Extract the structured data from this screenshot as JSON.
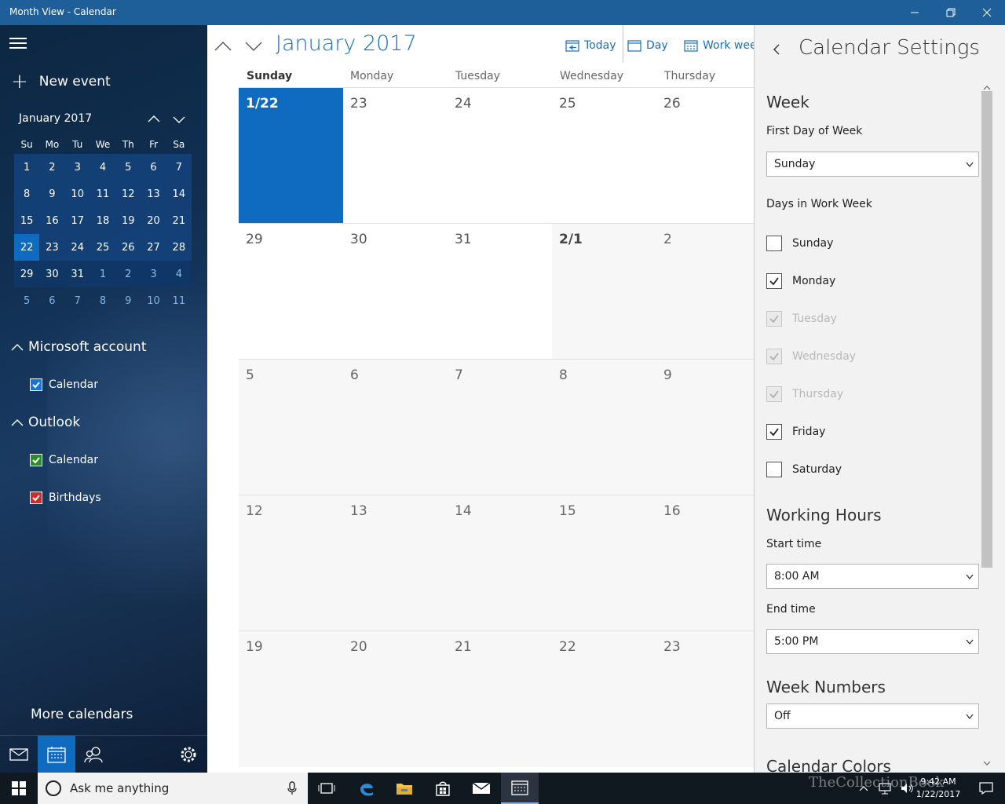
{
  "window": {
    "title": "Month View - Calendar"
  },
  "sidebar": {
    "new_event": "New event",
    "mini_calendar": {
      "title": "January 2017",
      "dow": [
        "Su",
        "Mo",
        "Tu",
        "We",
        "Th",
        "Fr",
        "Sa"
      ],
      "weeks": [
        [
          "1",
          "2",
          "3",
          "4",
          "5",
          "6",
          "7"
        ],
        [
          "8",
          "9",
          "10",
          "11",
          "12",
          "13",
          "14"
        ],
        [
          "15",
          "16",
          "17",
          "18",
          "19",
          "20",
          "21"
        ],
        [
          "22",
          "23",
          "24",
          "25",
          "26",
          "27",
          "28"
        ],
        [
          "29",
          "30",
          "31",
          "1",
          "2",
          "3",
          "4"
        ],
        [
          "5",
          "6",
          "7",
          "8",
          "9",
          "10",
          "11"
        ]
      ],
      "selected": "22"
    },
    "accounts": [
      {
        "name": "Microsoft account",
        "calendars": [
          {
            "label": "Calendar",
            "color": "#1a73d9"
          }
        ]
      },
      {
        "name": "Outlook",
        "calendars": [
          {
            "label": "Calendar",
            "color": "#2e8b2e"
          },
          {
            "label": "Birthdays",
            "color": "#c4302b"
          }
        ]
      }
    ],
    "more_calendars": "More calendars"
  },
  "main": {
    "month_title": "January 2017",
    "toolbar": {
      "today": "Today",
      "day": "Day",
      "work_week": "Work week"
    },
    "dow": [
      "Sunday",
      "Monday",
      "Tuesday",
      "Wednesday",
      "Thursday"
    ],
    "weeks": [
      [
        "1/22",
        "23",
        "24",
        "25",
        "26"
      ],
      [
        "29",
        "30",
        "31",
        "2/1",
        "2"
      ],
      [
        "5",
        "6",
        "7",
        "8",
        "9"
      ],
      [
        "12",
        "13",
        "14",
        "15",
        "16"
      ],
      [
        "19",
        "20",
        "21",
        "22",
        "23"
      ]
    ],
    "accent": "#0e6bbf"
  },
  "settings": {
    "title": "Calendar Settings",
    "week_section": "Week",
    "first_day_label": "First Day of Week",
    "first_day_value": "Sunday",
    "work_week_label": "Days in Work Week",
    "work_days": [
      {
        "label": "Sunday",
        "checked": false,
        "disabled": false
      },
      {
        "label": "Monday",
        "checked": true,
        "disabled": false
      },
      {
        "label": "Tuesday",
        "checked": true,
        "disabled": true
      },
      {
        "label": "Wednesday",
        "checked": true,
        "disabled": true
      },
      {
        "label": "Thursday",
        "checked": true,
        "disabled": true
      },
      {
        "label": "Friday",
        "checked": true,
        "disabled": false
      },
      {
        "label": "Saturday",
        "checked": false,
        "disabled": false
      }
    ],
    "working_hours_section": "Working Hours",
    "start_label": "Start time",
    "start_value": "8:00 AM",
    "end_label": "End time",
    "end_value": "5:00 PM",
    "week_numbers_section": "Week Numbers",
    "week_numbers_value": "Off",
    "calendar_colors_section": "Calendar Colors"
  },
  "taskbar": {
    "search_placeholder": "Ask me anything",
    "time": "9:42 AM",
    "date": "1/22/2017"
  },
  "watermark": "TheCollectionBook"
}
